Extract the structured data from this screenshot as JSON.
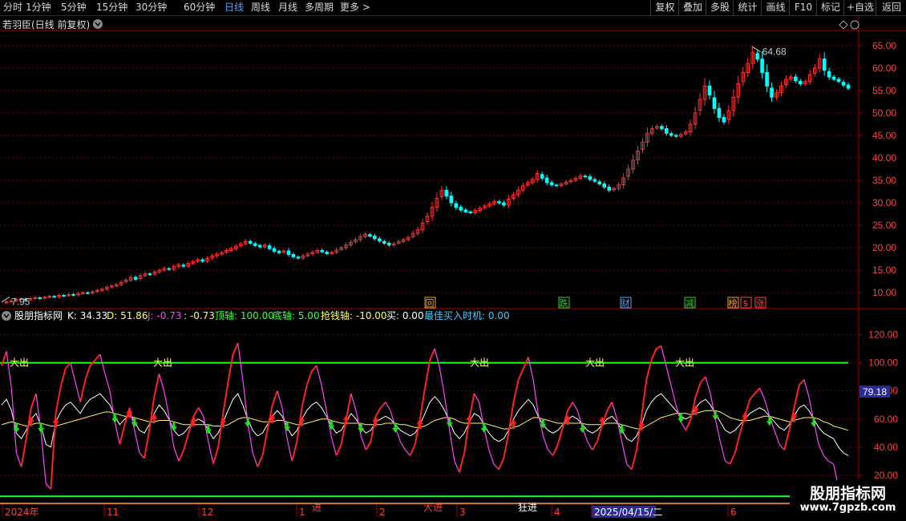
{
  "toolbar": {
    "periods": [
      "分时",
      "1分钟",
      "5分钟",
      "15分钟",
      "30分钟",
      "60分钟",
      "日线",
      "周线",
      "月线",
      "多周期",
      "更多 >"
    ],
    "selected_period": "日线",
    "right_buttons": [
      "复权",
      "叠加",
      "多股",
      "统计",
      "画线",
      "F10",
      "标记",
      "+自选",
      "返回"
    ]
  },
  "main_panel": {
    "title": "若羽臣(日线 前复权)",
    "high_label": "64.68",
    "low_label": "7.95",
    "y_ticks": [
      "65.00",
      "60.00",
      "55.00",
      "50.00",
      "45.00",
      "40.00",
      "35.00",
      "30.00",
      "25.00",
      "20.00",
      "15.00",
      "10.00"
    ],
    "event_badges": [
      {
        "text": "回",
        "color": "#e8a33c"
      },
      {
        "text": "跌",
        "color": "#37c837"
      },
      {
        "text": "财",
        "color": "#4aa3ff"
      },
      {
        "text": "减",
        "color": "#37c837"
      },
      {
        "text": "榜",
        "color": "#e8a33c"
      },
      {
        "text": "$",
        "color": "#ff4040"
      },
      {
        "text": "涨",
        "color": "#ff4040"
      }
    ]
  },
  "indicator_panel": {
    "name": "股朋指标网",
    "values": [
      {
        "label": "K: 34.33",
        "color": "#ffffff"
      },
      {
        "label": "D: 51.86",
        "color": "#ffff66"
      },
      {
        "label": "J: -0.73",
        "color": "#ff44ff"
      },
      {
        "label": ": -0.73",
        "color": "#ffff66"
      },
      {
        "label": "顶轴: 100.00",
        "color": "#44ff44"
      },
      {
        "label": "底轴: 5.00",
        "color": "#44ff44"
      },
      {
        "label": "抢钱轴: -10.00",
        "color": "#ffff66"
      },
      {
        "label": "买: 0.00",
        "color": "#ffffff"
      },
      {
        "label": "最佳买入时机: 0.00",
        "color": "#44ccff"
      }
    ],
    "y_ticks": [
      "120.00",
      "100.00",
      "80.00",
      "60.00",
      "40.00",
      "20.00"
    ],
    "current_value": "79.18",
    "sell_labels": [
      "大出",
      "大出",
      "大出",
      "大出",
      "大出"
    ],
    "buy_labels": [
      "进",
      "大进",
      "狂进"
    ]
  },
  "x_axis": {
    "labels": [
      "2024年",
      "11",
      "12",
      "1",
      "2",
      "3",
      "4",
      "2025/04/15/二",
      "6"
    ],
    "highlight": "2025/04/15/二"
  },
  "watermark": {
    "title": "股朋指标网",
    "url": "www.7gpzb.com"
  },
  "colors": {
    "up": "#ff3232",
    "down": "#00ffff",
    "grid": "#7a0000",
    "axis": "#a00000",
    "top_line": "#22ff22",
    "bottom_line": "#22ff22",
    "money_line": "#ffff66"
  },
  "chart_data": [
    {
      "type": "candlestick",
      "title": "若羽臣(日线 前复权)",
      "ylim": [
        7,
        68
      ],
      "high": 64.68,
      "low": 7.95,
      "close": [
        7.95,
        8.2,
        8.5,
        8.6,
        8.4,
        8.7,
        8.9,
        8.8,
        9.0,
        9.2,
        9.1,
        9.4,
        9.3,
        9.6,
        9.5,
        9.8,
        10.0,
        9.9,
        10.2,
        10.5,
        10.8,
        11.2,
        11.5,
        11.8,
        12.3,
        12.8,
        13.4,
        13.0,
        13.8,
        14.2,
        14.0,
        14.6,
        15.0,
        15.4,
        15.2,
        15.8,
        16.2,
        15.9,
        16.5,
        16.9,
        17.3,
        17.0,
        17.6,
        18.2,
        18.6,
        18.9,
        19.4,
        19.8,
        20.3,
        20.9,
        21.4,
        21.0,
        20.5,
        20.2,
        20.6,
        19.8,
        19.2,
        18.9,
        19.3,
        18.5,
        18.0,
        17.7,
        18.2,
        18.6,
        19.0,
        19.4,
        19.1,
        18.7,
        19.0,
        19.5,
        20.0,
        20.6,
        21.2,
        21.8,
        22.5,
        23.0,
        22.6,
        22.0,
        21.5,
        21.0,
        20.6,
        20.9,
        21.4,
        21.8,
        22.3,
        23.2,
        24.0,
        25.5,
        27.0,
        29.0,
        31.0,
        32.8,
        31.5,
        30.0,
        29.0,
        28.4,
        28.0,
        27.8,
        28.3,
        28.8,
        29.3,
        29.8,
        30.3,
        30.0,
        29.5,
        30.8,
        31.8,
        32.8,
        33.8,
        34.5,
        35.2,
        36.5,
        35.5,
        34.5,
        34.0,
        33.8,
        34.2,
        34.6,
        35.0,
        35.5,
        36.0,
        35.8,
        35.2,
        34.8,
        34.2,
        33.5,
        32.8,
        33.2,
        34.0,
        35.5,
        37.5,
        39.5,
        41.5,
        43.5,
        45.5,
        46.5,
        47.0,
        46.5,
        45.5,
        45.0,
        44.8,
        45.2,
        45.8,
        47.5,
        50.0,
        53.0,
        56.0,
        54.0,
        51.0,
        49.0,
        48.0,
        50.5,
        53.5,
        56.5,
        59.0,
        61.0,
        63.5,
        62.0,
        59.0,
        56.0,
        53.5,
        54.5,
        56.0,
        57.5,
        58.0,
        57.2,
        56.5,
        57.0,
        58.5,
        60.0,
        62.0,
        59.5,
        58.0,
        57.5,
        57.0,
        56.2,
        55.5
      ]
    },
    {
      "type": "line",
      "title": "股朋指标网",
      "ylim": [
        0,
        130
      ],
      "reference_lines": {
        "顶轴": 100,
        "底轴": 5,
        "抢钱轴": -10
      },
      "series": [
        {
          "name": "K",
          "values": [
            70,
            74,
            66,
            50,
            46,
            52,
            60,
            64,
            55,
            42,
            40,
            58,
            65,
            70,
            72,
            68,
            64,
            70,
            74,
            76,
            78,
            74,
            70,
            62,
            56,
            60,
            64,
            58,
            52,
            50,
            56,
            64,
            70,
            66,
            60,
            52,
            48,
            50,
            54,
            58,
            60,
            58,
            52,
            46,
            50,
            58,
            66,
            74,
            78,
            70,
            60,
            52,
            48,
            50,
            56,
            62,
            66,
            62,
            54,
            48,
            52,
            60,
            66,
            70,
            72,
            68,
            62,
            55,
            50,
            52,
            58,
            64,
            60,
            54,
            50,
            52,
            58,
            60,
            62,
            60,
            56,
            52,
            50,
            48,
            50,
            56,
            64,
            72,
            76,
            72,
            66,
            58,
            50,
            46,
            50,
            58,
            64,
            62,
            56,
            50,
            46,
            44,
            46,
            52,
            60,
            66,
            70,
            74,
            70,
            62,
            56,
            52,
            50,
            52,
            56,
            60,
            62,
            60,
            56,
            52,
            50,
            52,
            56,
            60,
            62,
            58,
            52,
            46,
            44,
            48,
            56,
            66,
            72,
            76,
            78,
            74,
            70,
            66,
            62,
            60,
            62,
            68,
            72,
            74,
            70,
            64,
            58,
            52,
            50,
            52,
            56,
            60,
            64,
            66,
            68,
            66,
            62,
            58,
            54,
            52,
            56,
            62,
            68,
            70,
            66,
            60,
            54,
            50,
            48,
            46,
            40,
            36,
            34
          ]
        },
        {
          "name": "D",
          "values": [
            56,
            57,
            58,
            57,
            56,
            55,
            56,
            57,
            57,
            56,
            55,
            55,
            56,
            57,
            58,
            59,
            60,
            61,
            62,
            63,
            64,
            65,
            65,
            64,
            63,
            62,
            62,
            61,
            60,
            59,
            58,
            58,
            59,
            59,
            59,
            58,
            57,
            56,
            56,
            56,
            56,
            56,
            56,
            55,
            55,
            55,
            56,
            58,
            60,
            61,
            61,
            60,
            59,
            58,
            58,
            58,
            59,
            59,
            58,
            57,
            56,
            56,
            57,
            58,
            59,
            60,
            60,
            59,
            58,
            57,
            57,
            57,
            57,
            57,
            56,
            56,
            56,
            56,
            57,
            57,
            57,
            56,
            56,
            55,
            54,
            54,
            55,
            57,
            59,
            60,
            61,
            61,
            60,
            58,
            57,
            57,
            57,
            57,
            57,
            56,
            55,
            54,
            53,
            53,
            54,
            55,
            57,
            59,
            61,
            61,
            60,
            59,
            58,
            57,
            57,
            57,
            57,
            57,
            57,
            56,
            56,
            56,
            56,
            57,
            57,
            57,
            56,
            55,
            54,
            53,
            53,
            55,
            57,
            59,
            61,
            62,
            63,
            64,
            64,
            64,
            63,
            64,
            65,
            66,
            66,
            66,
            65,
            63,
            61,
            60,
            59,
            59,
            59,
            60,
            61,
            62,
            62,
            61,
            60,
            59,
            58,
            59,
            60,
            61,
            61,
            61,
            60,
            58,
            57,
            55,
            54,
            53,
            52
          ]
        }
      ]
    }
  ]
}
